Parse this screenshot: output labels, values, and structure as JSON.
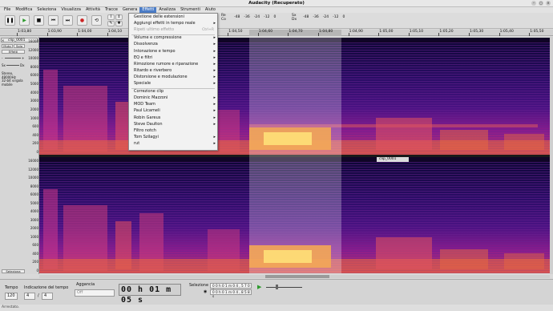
{
  "window": {
    "title": "Audacity (Recuperato)"
  },
  "menubar": [
    "File",
    "Modifica",
    "Seleziona",
    "Visualizza",
    "Attività",
    "Tracce",
    "Genera",
    "Effetti",
    "Analizza",
    "Strumenti",
    "Aiuto"
  ],
  "toolbar": {
    "meter_record": {
      "ticks": [
        "-48",
        "-36",
        "-24",
        "-12",
        "0"
      ]
    },
    "meter_play": {
      "ticks": [
        "-48",
        "-36",
        "-24",
        "-12",
        "0"
      ]
    },
    "record_label": "Re\nCo"
  },
  "ruler": {
    "ticks": [
      "1:03,80",
      "1:03,90",
      "1:04,00",
      "1:04,10",
      "1:04,20",
      "1:04,30",
      "1:04,40",
      "1:04,50",
      "1:04,60",
      "1:04,70",
      "1:04,80",
      "1:04,90",
      "1:05,00",
      "1:05,10",
      "1:05,20",
      "1:05,30",
      "1:05,40",
      "1:05,50"
    ]
  },
  "track": {
    "name": "clip_0001",
    "clip_label": "clip_0001",
    "mute": "Muto",
    "solo": "Solo",
    "effects": "Effetti",
    "info": "Stereo, 48000Hz\n32-bit virgola mobile",
    "select_button": "Seleziona",
    "gain_min": "-",
    "gain_max": "+",
    "pan_left": "Sx",
    "pan_right": "Dx"
  },
  "axis_top": [
    "16000",
    "12000",
    "10000",
    "8000",
    "6000",
    "5000",
    "4000",
    "3000",
    "2000",
    "1000",
    "600",
    "400",
    "200",
    "0"
  ],
  "axis_bottom": [
    "16000",
    "12000",
    "10000",
    "8000",
    "6000",
    "5000",
    "4000",
    "3000",
    "2000",
    "1000",
    "600",
    "400",
    "200",
    "0"
  ],
  "menu": {
    "items": [
      {
        "label": "Gestione delle estensioni",
        "type": "item"
      },
      {
        "label": "Aggiungi effetti in tempo reale",
        "type": "sub"
      },
      {
        "label": "Ripeti ultimo effetto",
        "type": "disabled",
        "shortcut": "Ctrl+R"
      },
      {
        "label": "Volume e compressione",
        "type": "sub"
      },
      {
        "label": "Dissolvenza",
        "type": "sub"
      },
      {
        "label": "Intonazione e tempo",
        "type": "sub"
      },
      {
        "label": "EQ e filtri",
        "type": "sub"
      },
      {
        "label": "Rimozione rumore e riparazione",
        "type": "sub"
      },
      {
        "label": "Ritardo e riverbero",
        "type": "sub"
      },
      {
        "label": "Distorsione e modulazione",
        "type": "sub"
      },
      {
        "label": "Speciale",
        "type": "sub"
      },
      {
        "label": "Correzione clip",
        "type": "item"
      },
      {
        "label": "Dominic Mazzoni",
        "type": "sub"
      },
      {
        "label": "MOD Team",
        "type": "sub"
      },
      {
        "label": "Paul Licameli",
        "type": "sub"
      },
      {
        "label": "Robin Gareus",
        "type": "sub"
      },
      {
        "label": "Steve Daulton",
        "type": "sub"
      },
      {
        "label": "Filtro notch",
        "type": "item"
      },
      {
        "label": "Tom Szilagyi",
        "type": "sub"
      },
      {
        "label": "rut",
        "type": "sub"
      }
    ]
  },
  "bottom": {
    "tempo_label": "Tempo",
    "tempo_value": "120",
    "timesig_label": "Indicazione del tempo",
    "timesig_num": "4",
    "timesig_den": "4",
    "snap_label": "Aggancia",
    "snap_value": "Off",
    "time_display": "00 h 01 m 05 s",
    "selection_label": "Selezione",
    "sel_start": "0 0 h 0 1 m 0 4 , 5 7 0 s",
    "sel_end": "0 0 h 0 1 m 0 4 , 8 5 8 s"
  },
  "status": "Arrestato."
}
